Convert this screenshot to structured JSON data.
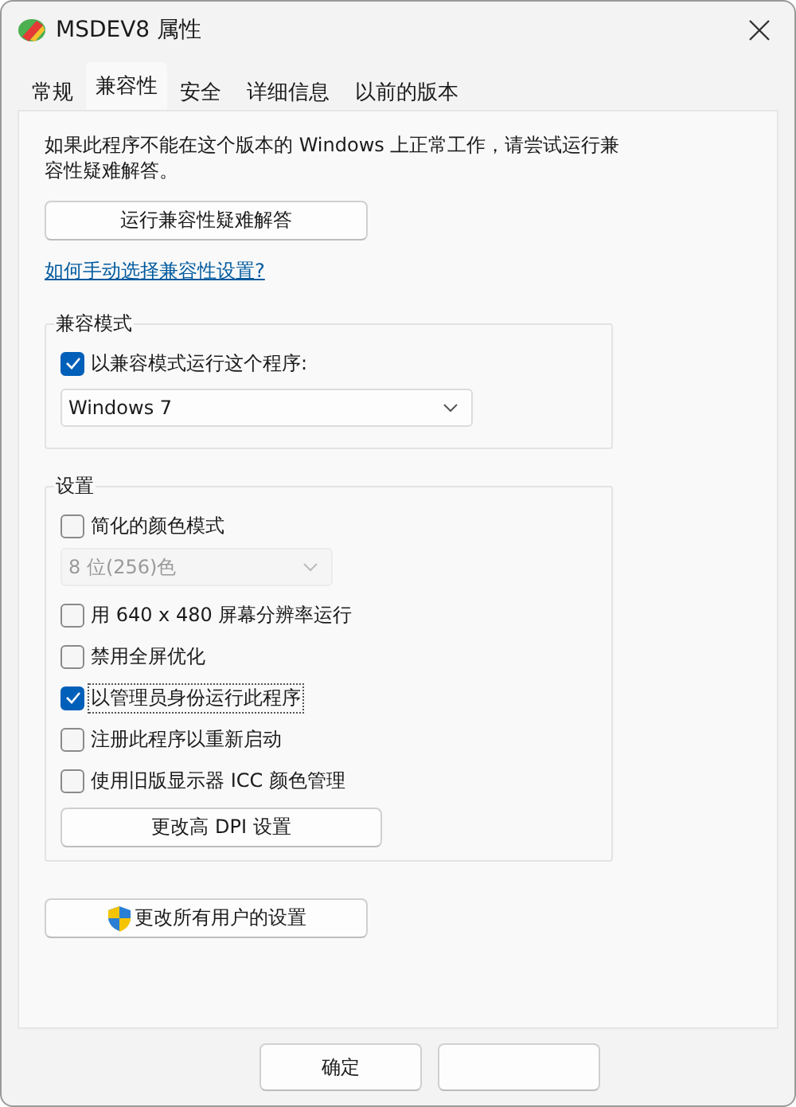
{
  "window": {
    "title": "MSDEV8 属性"
  },
  "tabs": [
    {
      "label": "常规",
      "selected": false
    },
    {
      "label": "兼容性",
      "selected": true
    },
    {
      "label": "安全",
      "selected": false
    },
    {
      "label": "详细信息",
      "selected": false
    },
    {
      "label": "以前的版本",
      "selected": false
    }
  ],
  "description": "如果此程序不能在这个版本的 Windows 上正常工作，请尝试运行兼容性疑难解答。",
  "troubleshoot_button": "运行兼容性疑难解答",
  "help_link": "如何手动选择兼容性设置?",
  "compat_mode": {
    "label": "兼容模式",
    "checkbox": {
      "label": "以兼容模式运行这个程序:",
      "checked": true
    },
    "select": {
      "value": "Windows 7",
      "disabled": false
    }
  },
  "settings": {
    "label": "设置",
    "items": [
      {
        "kind": "checkbox",
        "label": "简化的颜色模式",
        "checked": false,
        "focused": false
      },
      {
        "kind": "select",
        "value": "8 位(256)色",
        "disabled": true
      },
      {
        "kind": "checkbox",
        "label": "用 640 x 480 屏幕分辨率运行",
        "checked": false,
        "focused": false
      },
      {
        "kind": "checkbox",
        "label": "禁用全屏优化",
        "checked": false,
        "focused": false
      },
      {
        "kind": "checkbox",
        "label": "以管理员身份运行此程序",
        "checked": true,
        "focused": true
      },
      {
        "kind": "checkbox",
        "label": "注册此程序以重新启动",
        "checked": false,
        "focused": false
      },
      {
        "kind": "checkbox",
        "label": "使用旧版显示器 ICC 颜色管理",
        "checked": false,
        "focused": false
      }
    ],
    "button": "更改高 DPI 设置"
  },
  "all_users_button": "更改所有用户的设置",
  "footer_buttons": [
    "确定"
  ]
}
